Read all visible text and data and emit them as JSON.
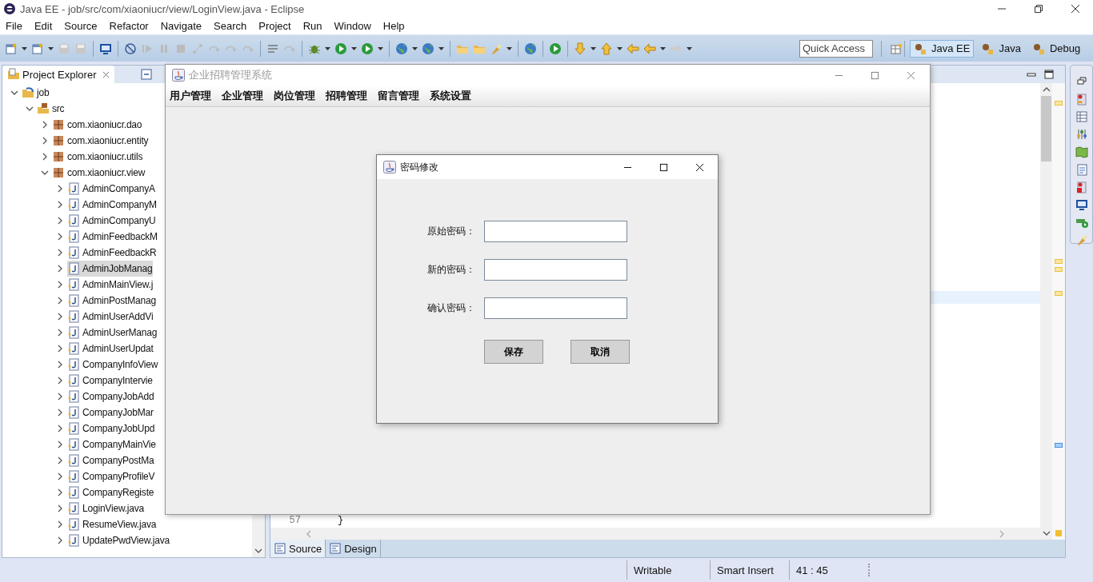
{
  "window": {
    "title": "Java EE - job/src/com/xiaoniucr/view/LoginView.java - Eclipse"
  },
  "menu": [
    "File",
    "Edit",
    "Source",
    "Refactor",
    "Navigate",
    "Search",
    "Project",
    "Run",
    "Window",
    "Help"
  ],
  "quick_access": {
    "placeholder": "Quick Access"
  },
  "perspectives": [
    {
      "label": "Java EE",
      "selected": true
    },
    {
      "label": "Java",
      "selected": false
    },
    {
      "label": "Debug",
      "selected": false
    }
  ],
  "project_explorer": {
    "title": "Project Explorer",
    "tree": [
      {
        "label": "job",
        "kind": "project",
        "expanded": true,
        "selected": false,
        "children": [
          {
            "label": "src",
            "kind": "source-folder",
            "expanded": true,
            "selected": false,
            "children": [
              {
                "label": "com.xiaoniucr.dao",
                "kind": "package",
                "expanded": false,
                "selected": false
              },
              {
                "label": "com.xiaoniucr.entity",
                "kind": "package",
                "expanded": false,
                "selected": false
              },
              {
                "label": "com.xiaoniucr.utils",
                "kind": "package",
                "expanded": false,
                "selected": false
              },
              {
                "label": "com.xiaoniucr.view",
                "kind": "package",
                "expanded": true,
                "selected": false,
                "children": [
                  {
                    "label": "AdminCompanyA",
                    "kind": "file",
                    "expanded": false,
                    "selected": false
                  },
                  {
                    "label": "AdminCompanyM",
                    "kind": "file",
                    "expanded": false,
                    "selected": false
                  },
                  {
                    "label": "AdminCompanyU",
                    "kind": "file",
                    "expanded": false,
                    "selected": false
                  },
                  {
                    "label": "AdminFeedbackM",
                    "kind": "file",
                    "expanded": false,
                    "selected": false
                  },
                  {
                    "label": "AdminFeedbackR",
                    "kind": "file",
                    "expanded": false,
                    "selected": false
                  },
                  {
                    "label": "AdminJobManag",
                    "kind": "file",
                    "expanded": false,
                    "selected": true
                  },
                  {
                    "label": "AdminMainView.j",
                    "kind": "file",
                    "expanded": false,
                    "selected": false
                  },
                  {
                    "label": "AdminPostManag",
                    "kind": "file",
                    "expanded": false,
                    "selected": false
                  },
                  {
                    "label": "AdminUserAddVi",
                    "kind": "file",
                    "expanded": false,
                    "selected": false
                  },
                  {
                    "label": "AdminUserManag",
                    "kind": "file",
                    "expanded": false,
                    "selected": false
                  },
                  {
                    "label": "AdminUserUpdat",
                    "kind": "file",
                    "expanded": false,
                    "selected": false
                  },
                  {
                    "label": "CompanyInfoView",
                    "kind": "file",
                    "expanded": false,
                    "selected": false
                  },
                  {
                    "label": "CompanyIntervie",
                    "kind": "file",
                    "expanded": false,
                    "selected": false
                  },
                  {
                    "label": "CompanyJobAdd",
                    "kind": "file",
                    "expanded": false,
                    "selected": false
                  },
                  {
                    "label": "CompanyJobMar",
                    "kind": "file",
                    "expanded": false,
                    "selected": false
                  },
                  {
                    "label": "CompanyJobUpd",
                    "kind": "file",
                    "expanded": false,
                    "selected": false
                  },
                  {
                    "label": "CompanyMainVie",
                    "kind": "file",
                    "expanded": false,
                    "selected": false
                  },
                  {
                    "label": "CompanyPostMa",
                    "kind": "file",
                    "expanded": false,
                    "selected": false
                  },
                  {
                    "label": "CompanyProfileV",
                    "kind": "file",
                    "expanded": false,
                    "selected": false
                  },
                  {
                    "label": "CompanyRegiste",
                    "kind": "file",
                    "expanded": false,
                    "selected": false
                  },
                  {
                    "label": "LoginView.java",
                    "kind": "file",
                    "expanded": false,
                    "selected": false
                  },
                  {
                    "label": "ResumeView.java",
                    "kind": "file",
                    "expanded": false,
                    "selected": false
                  },
                  {
                    "label": "UpdatePwdView.java",
                    "kind": "file",
                    "expanded": false,
                    "selected": false
                  }
                ]
              }
            ]
          }
        ]
      }
    ]
  },
  "editor": {
    "line_number": "57",
    "code": "}",
    "tabs": [
      {
        "label": "Source",
        "selected": true
      },
      {
        "label": "Design",
        "selected": false
      }
    ]
  },
  "status_bar": [
    "Writable",
    "Smart Insert",
    "41 : 45"
  ],
  "app_window": {
    "title": "企业招聘管理系统",
    "menu": [
      "用户管理",
      "企业管理",
      "岗位管理",
      "招聘管理",
      "留言管理",
      "系统设置"
    ]
  },
  "dialog": {
    "title": "密码修改",
    "fields": [
      {
        "label": "原始密码："
      },
      {
        "label": "新的密码："
      },
      {
        "label": "确认密码："
      }
    ],
    "buttons": [
      "保存",
      "取消"
    ]
  }
}
